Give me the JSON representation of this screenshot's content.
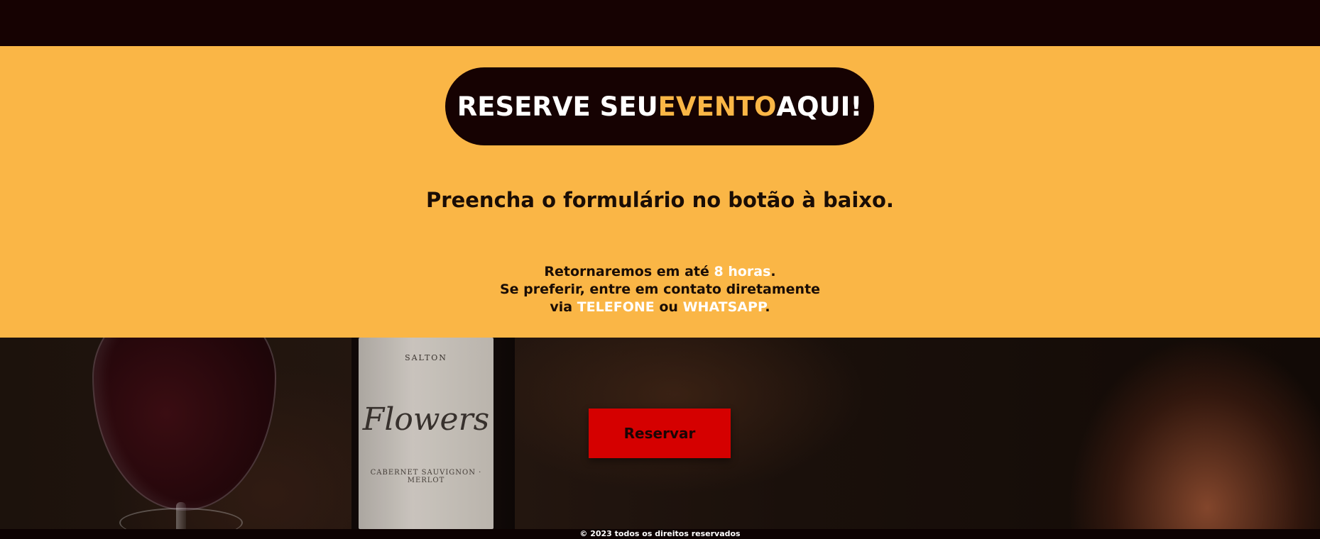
{
  "header": {
    "title_part1": "RESERVE SEU ",
    "title_accent": "EVENTO",
    "title_part2": " AQUI!"
  },
  "main": {
    "subtitle": "Preencha o formulário no botão à baixo.",
    "info_line1_before": "Retornaremos em até ",
    "info_line1_highlight": "8 horas",
    "info_line1_after": ".",
    "info_line2": "Se preferir, entre em contato diretamente",
    "info_line3_before": "via ",
    "info_line3_highlight1": "TELEFONE",
    "info_line3_middle": " ou ",
    "info_line3_highlight2": "WHATSAPP",
    "info_line3_after": "."
  },
  "photo": {
    "label_small": "SALTON",
    "label_brand": "Flowers",
    "label_desc": "CABERNET SAUVIGNON · MERLOT"
  },
  "cta": {
    "reserve_label": "Reservar"
  },
  "footer": {
    "copyright": "© 2023 todos os direitos reservados"
  },
  "colors": {
    "dark": "#160202",
    "accent_yellow": "#FAB646",
    "button_red": "#D50000",
    "highlight_text": "#FFFFFF"
  }
}
